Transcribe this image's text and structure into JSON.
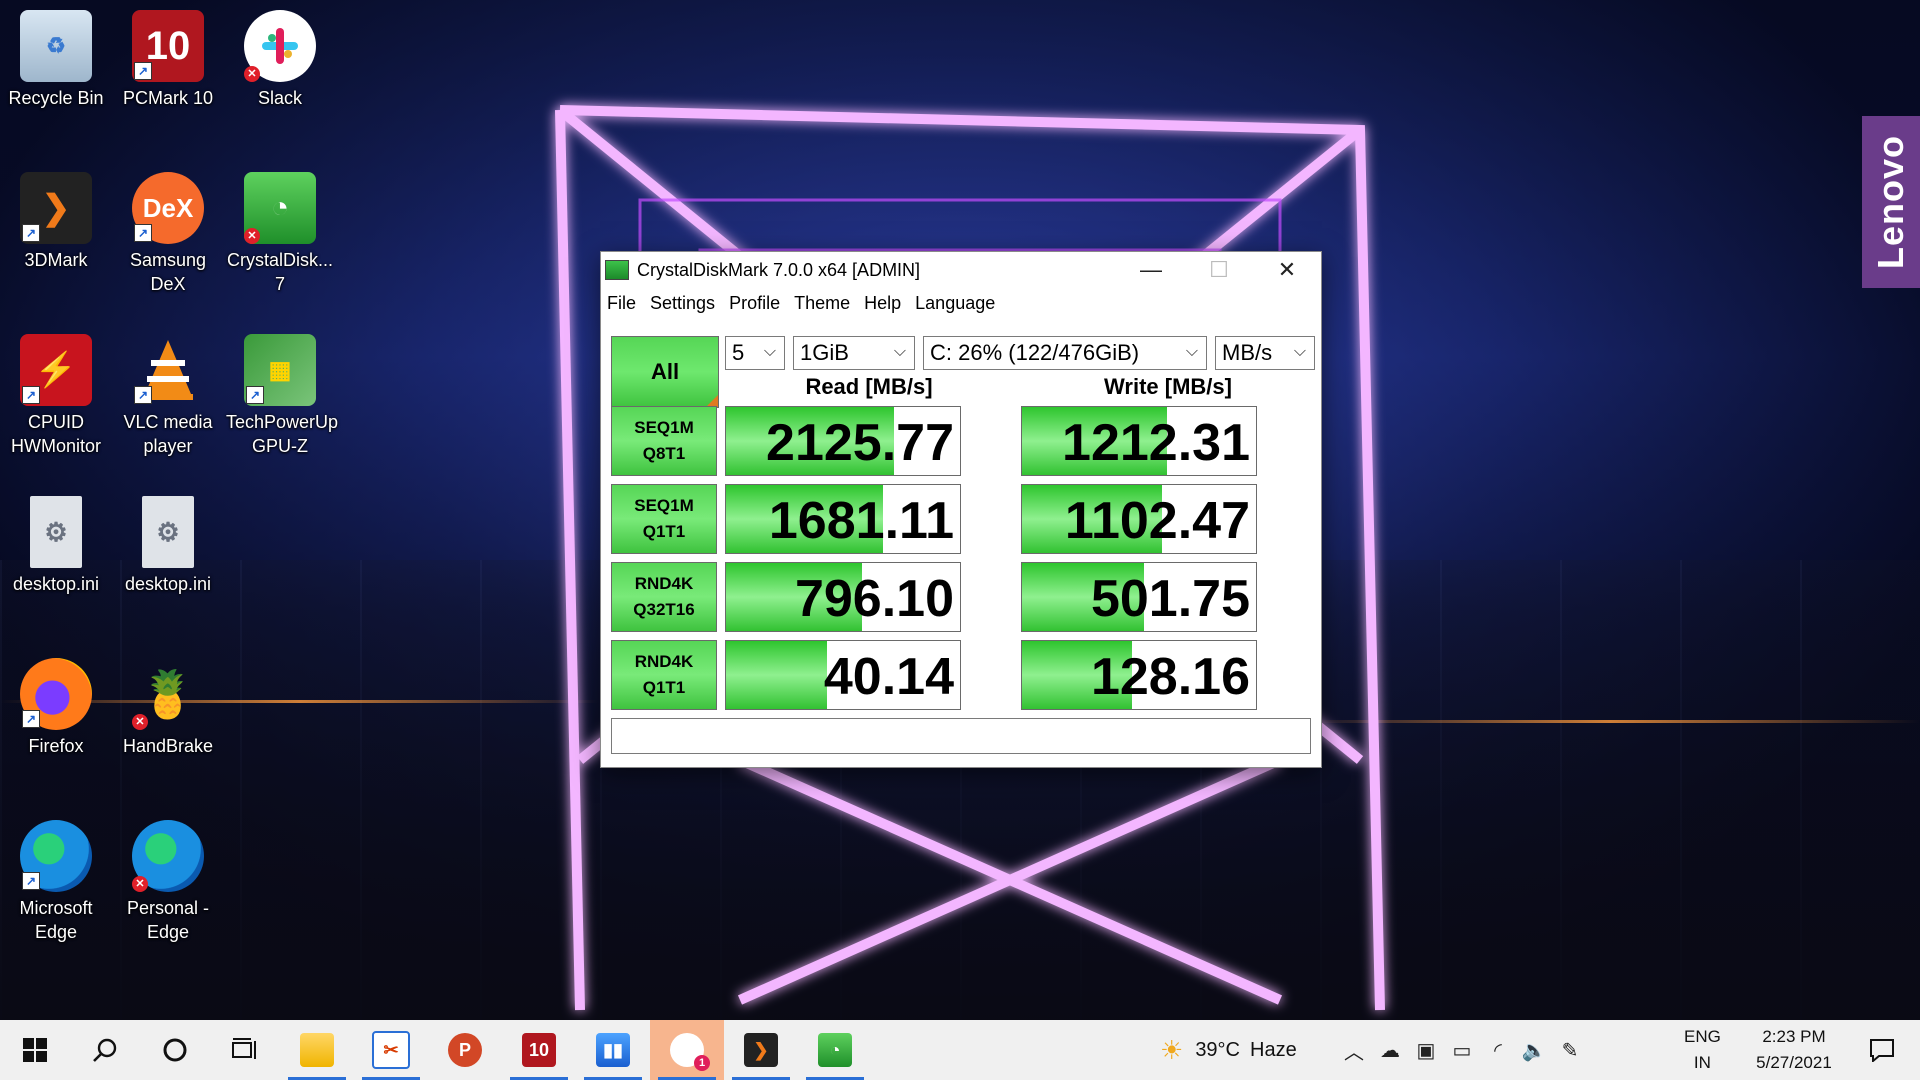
{
  "desktop": {
    "icons": [
      {
        "label": "Recycle Bin",
        "icon": "recycle-bin-icon"
      },
      {
        "label": "PCMark 10",
        "icon": "pcmark-icon"
      },
      {
        "label": "Slack",
        "icon": "slack-icon"
      },
      {
        "label": "3DMark",
        "icon": "3dmark-icon"
      },
      {
        "label": "Samsung DeX",
        "icon": "samsung-dex-icon"
      },
      {
        "label": "CrystalDisk... 7",
        "icon": "crystaldiskmark-icon"
      },
      {
        "label": "CPUID HWMonitor",
        "icon": "hwmonitor-icon"
      },
      {
        "label": "VLC media player",
        "icon": "vlc-icon"
      },
      {
        "label": "TechPowerUp GPU-Z",
        "icon": "gpuz-icon"
      },
      {
        "label": "desktop.ini",
        "icon": "settings-file-icon"
      },
      {
        "label": "desktop.ini",
        "icon": "settings-file-icon"
      },
      {
        "label": "Firefox",
        "icon": "firefox-icon"
      },
      {
        "label": "HandBrake",
        "icon": "handbrake-icon"
      },
      {
        "label": "Microsoft Edge",
        "icon": "edge-icon"
      },
      {
        "label": "Personal - Edge",
        "icon": "edge-profile-icon"
      }
    ],
    "icon_text": {
      "pcmark": "10",
      "dex": "DeX"
    },
    "side_tab": "Lenovo"
  },
  "window": {
    "title": "CrystalDiskMark 7.0.0 x64 [ADMIN]",
    "controls": {
      "minimize": "—",
      "maximize": "☐",
      "close": "✕"
    },
    "menu": [
      "File",
      "Settings",
      "Profile",
      "Theme",
      "Help",
      "Language"
    ],
    "all_button": "All",
    "test_count": "5",
    "test_size": "1GiB",
    "drive": "C: 26% (122/476GiB)",
    "unit": "MB/s",
    "read_header": "Read [MB/s]",
    "write_header": "Write [MB/s]",
    "tests": [
      {
        "line1": "SEQ1M",
        "line2": "Q8T1",
        "read": "2125.77",
        "write": "1212.31",
        "read_fill": 0.72,
        "write_fill": 0.62
      },
      {
        "line1": "SEQ1M",
        "line2": "Q1T1",
        "read": "1681.11",
        "write": "1102.47",
        "read_fill": 0.67,
        "write_fill": 0.6
      },
      {
        "line1": "RND4K",
        "line2": "Q32T16",
        "read": "796.10",
        "write": "501.75",
        "read_fill": 0.58,
        "write_fill": 0.52
      },
      {
        "line1": "RND4K",
        "line2": "Q1T1",
        "read": "40.14",
        "write": "128.16",
        "read_fill": 0.43,
        "write_fill": 0.47
      }
    ],
    "comment": ""
  },
  "taskbar": {
    "apps": [
      {
        "name": "start",
        "icon": "windows-logo-icon"
      },
      {
        "name": "search",
        "icon": "search-icon"
      },
      {
        "name": "cortana",
        "icon": "cortana-ring-icon"
      },
      {
        "name": "task-view",
        "icon": "task-view-icon"
      },
      {
        "name": "file-explorer",
        "icon": "folder-icon"
      },
      {
        "name": "snip",
        "icon": "snipping-tool-icon"
      },
      {
        "name": "powerpoint",
        "icon": "powerpoint-icon",
        "text": "P"
      },
      {
        "name": "pcmark",
        "icon": "pcmark-icon",
        "text": "10"
      },
      {
        "name": "gpu-tool",
        "icon": "chart-app-icon"
      },
      {
        "name": "slack",
        "icon": "slack-icon",
        "badge": "1"
      },
      {
        "name": "3dmark",
        "icon": "3dmark-icon"
      },
      {
        "name": "crystaldiskmark",
        "icon": "crystaldiskmark-icon"
      }
    ],
    "weather": {
      "temp": "39°C",
      "condition": "Haze"
    },
    "lang": {
      "line1": "ENG",
      "line2": "IN"
    },
    "clock": {
      "time": "2:23 PM",
      "date": "5/27/2021"
    }
  }
}
